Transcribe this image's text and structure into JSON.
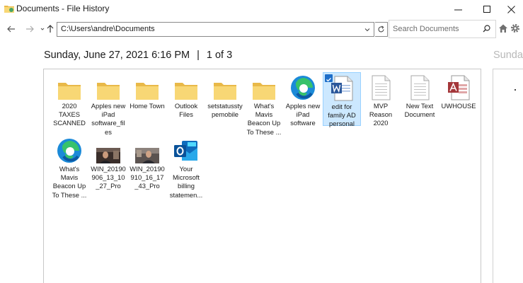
{
  "window": {
    "title": "Documents - File History"
  },
  "toolbar": {
    "address": "C:\\Users\\andre\\Documents",
    "search_placeholder": "Search Documents"
  },
  "header": {
    "date": "Sunday, June 27, 2021 6:16 PM",
    "separator": "|",
    "page": "1 of 3",
    "next_date": "Sunday"
  },
  "files": [
    {
      "label": "2020 TAXES SCANNED",
      "icon": "folder-icon"
    },
    {
      "label": "Apples new iPad software_files",
      "icon": "folder-icon"
    },
    {
      "label": "Home Town",
      "icon": "folder-icon"
    },
    {
      "label": "Outlook Files",
      "icon": "folder-icon"
    },
    {
      "label": "setstatusstypemobile",
      "icon": "folder-icon"
    },
    {
      "label": "What's Mavis Beacon Up To These ...",
      "icon": "folder-icon"
    },
    {
      "label": "Apples new iPad software",
      "icon": "edge-icon"
    },
    {
      "label": "edit for family AD personal",
      "icon": "word-doc-icon",
      "selected": true
    },
    {
      "label": "MVP Reason 2020",
      "icon": "text-doc-icon"
    },
    {
      "label": "New Text Document",
      "icon": "text-doc-icon"
    },
    {
      "label": "UWHOUSE",
      "icon": "access-db-icon"
    },
    {
      "label": "What's Mavis Beacon Up To These ...",
      "icon": "edge-icon"
    },
    {
      "label": "WIN_20190906_13_10_27_Pro",
      "icon": "photo-thumbnail-icon"
    },
    {
      "label": "WIN_20190910_16_17_43_Pro",
      "icon": "photo-thumbnail-icon"
    },
    {
      "label": "Your Microsoft billing statemen...",
      "icon": "outlook-msg-icon"
    }
  ],
  "colors": {
    "folder": "#f8d775",
    "folder_back": "#e9b949",
    "selection": "#cce8ff",
    "edge": "#1b8ad8",
    "word": "#2b579a",
    "access": "#a4373a",
    "outlook": "#0f6cbd"
  }
}
